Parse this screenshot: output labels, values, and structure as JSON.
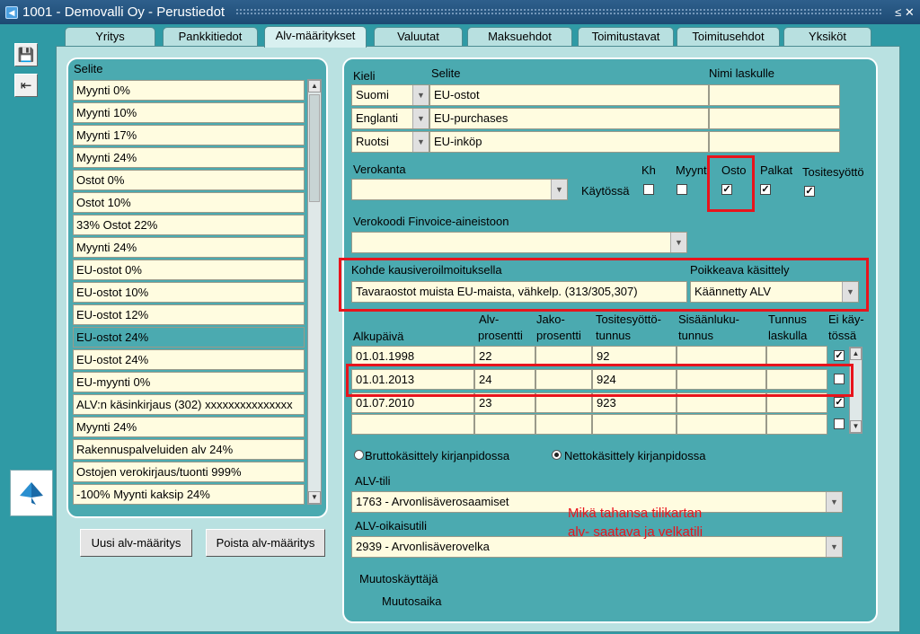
{
  "window": {
    "title": "1001 - Demovalli Oy - Perustiedot",
    "controls": "≤ ✕"
  },
  "toolbar": {
    "save_icon": "save-icon",
    "exit_icon": "exit-icon"
  },
  "tabs": [
    {
      "label": "Yritys"
    },
    {
      "label": "Pankkitiedot"
    },
    {
      "label": "Alv-määritykset"
    },
    {
      "label": "Valuutat"
    },
    {
      "label": "Maksuehdot"
    },
    {
      "label": "Toimitustavat"
    },
    {
      "label": "Toimitusehdot"
    },
    {
      "label": "Yksiköt"
    }
  ],
  "list": {
    "header": "Selite",
    "items": [
      {
        "label": "Myynti 0%"
      },
      {
        "label": "Myynti 10%"
      },
      {
        "label": "Myynti 17%"
      },
      {
        "label": "Myynti 24%"
      },
      {
        "label": "Ostot 0%"
      },
      {
        "label": "Ostot 10%"
      },
      {
        "label": "33% Ostot 22%"
      },
      {
        "label": "Myynti 24%"
      },
      {
        "label": "EU-ostot 0%"
      },
      {
        "label": "EU-ostot 10%"
      },
      {
        "label": "EU-ostot 12%"
      },
      {
        "label": "EU-ostot 24%"
      },
      {
        "label": "EU-ostot 24%"
      },
      {
        "label": "EU-myynti 0%"
      },
      {
        "label": "ALV:n käsinkirjaus (302) xxxxxxxxxxxxxxx"
      },
      {
        "label": "Myynti 24%"
      },
      {
        "label": "Rakennuspalveluiden alv 24%"
      },
      {
        "label": "Ostojen verokirjaus/tuonti 999%"
      },
      {
        "label": "-100% Myynti  kaksip 24%"
      }
    ],
    "selected_index": 11
  },
  "buttons": {
    "new": "Uusi alv-määritys",
    "delete": "Poista alv-määritys"
  },
  "lang": {
    "col_kieli": "Kieli",
    "col_selite": "Selite",
    "col_nimi": "Nimi laskulle",
    "rows": [
      {
        "lang": "Suomi",
        "selite": "EU-ostot",
        "nimi": ""
      },
      {
        "lang": "Englanti",
        "selite": "EU-purchases",
        "nimi": ""
      },
      {
        "lang": "Ruotsi",
        "selite": "EU-inköp",
        "nimi": ""
      }
    ]
  },
  "verokanta": {
    "label": "Verokanta",
    "value": ""
  },
  "kaytossa": {
    "label": "Käytössä",
    "kh": {
      "label": "Kh",
      "checked": false
    },
    "myynti": {
      "label": "Myynti",
      "checked": false
    },
    "osto": {
      "label": "Osto",
      "checked": true
    },
    "palkat": {
      "label": "Palkat",
      "checked": true
    },
    "tositesyotto": {
      "label": "Tositesyöttö",
      "checked": true
    }
  },
  "finvoice": {
    "label": "Verokoodi Finvoice-aineistoon",
    "value": ""
  },
  "kohde": {
    "label": "Kohde kausiveroilmoituksella",
    "value": "Tavaraostot muista EU-maista, vähkelp. (313/305,307)"
  },
  "poikkeava": {
    "label": "Poikkeava käsittely",
    "value": "Käännetty ALV"
  },
  "periods": {
    "headers": {
      "alkupaiva": "Alkupäivä",
      "alv1": "Alv-",
      "alv2": "prosentti",
      "jako1": "Jako-",
      "jako2": "prosentti",
      "tos1": "Tositesyöttö-",
      "tos2": "tunnus",
      "sis1": "Sisäänluku-",
      "sis2": "tunnus",
      "tun1": "Tunnus",
      "tun2": "laskulla",
      "ei1": "Ei käy-",
      "ei2": "tössä"
    },
    "rows": [
      {
        "alkupaiva": "01.01.1998",
        "alv": "22",
        "jako": "",
        "tos": "92",
        "sis": "",
        "tun": "",
        "ei": true
      },
      {
        "alkupaiva": "01.01.2013",
        "alv": "24",
        "jako": "",
        "tos": "924",
        "sis": "",
        "tun": "",
        "ei": false
      },
      {
        "alkupaiva": "01.07.2010",
        "alv": "23",
        "jako": "",
        "tos": "923",
        "sis": "",
        "tun": "",
        "ei": true
      },
      {
        "alkupaiva": "",
        "alv": "",
        "jako": "",
        "tos": "",
        "sis": "",
        "tun": "",
        "ei": false
      }
    ]
  },
  "kasittely": {
    "brutto": "Bruttokäsittely kirjanpidossa",
    "netto": "Nettokäsittely kirjanpidossa",
    "selected": "netto"
  },
  "alvtili": {
    "label": "ALV-tili",
    "value": "1763 - Arvonlisäverosaamiset"
  },
  "oikaisutili": {
    "label": "ALV-oikaisutili",
    "value": "2939 - Arvonlisäverovelka"
  },
  "muutoskayttaja": {
    "label": "Muutoskäyttäjä"
  },
  "muutosaika": {
    "label": "Muutosaika"
  },
  "annotation": {
    "line1": "Mikä tahansa tilikartan",
    "line2": "alv- saatava ja velkatili"
  },
  "colors": {
    "highlight": "#e8141c",
    "panel": "#4baab0",
    "field": "#fffce0"
  }
}
